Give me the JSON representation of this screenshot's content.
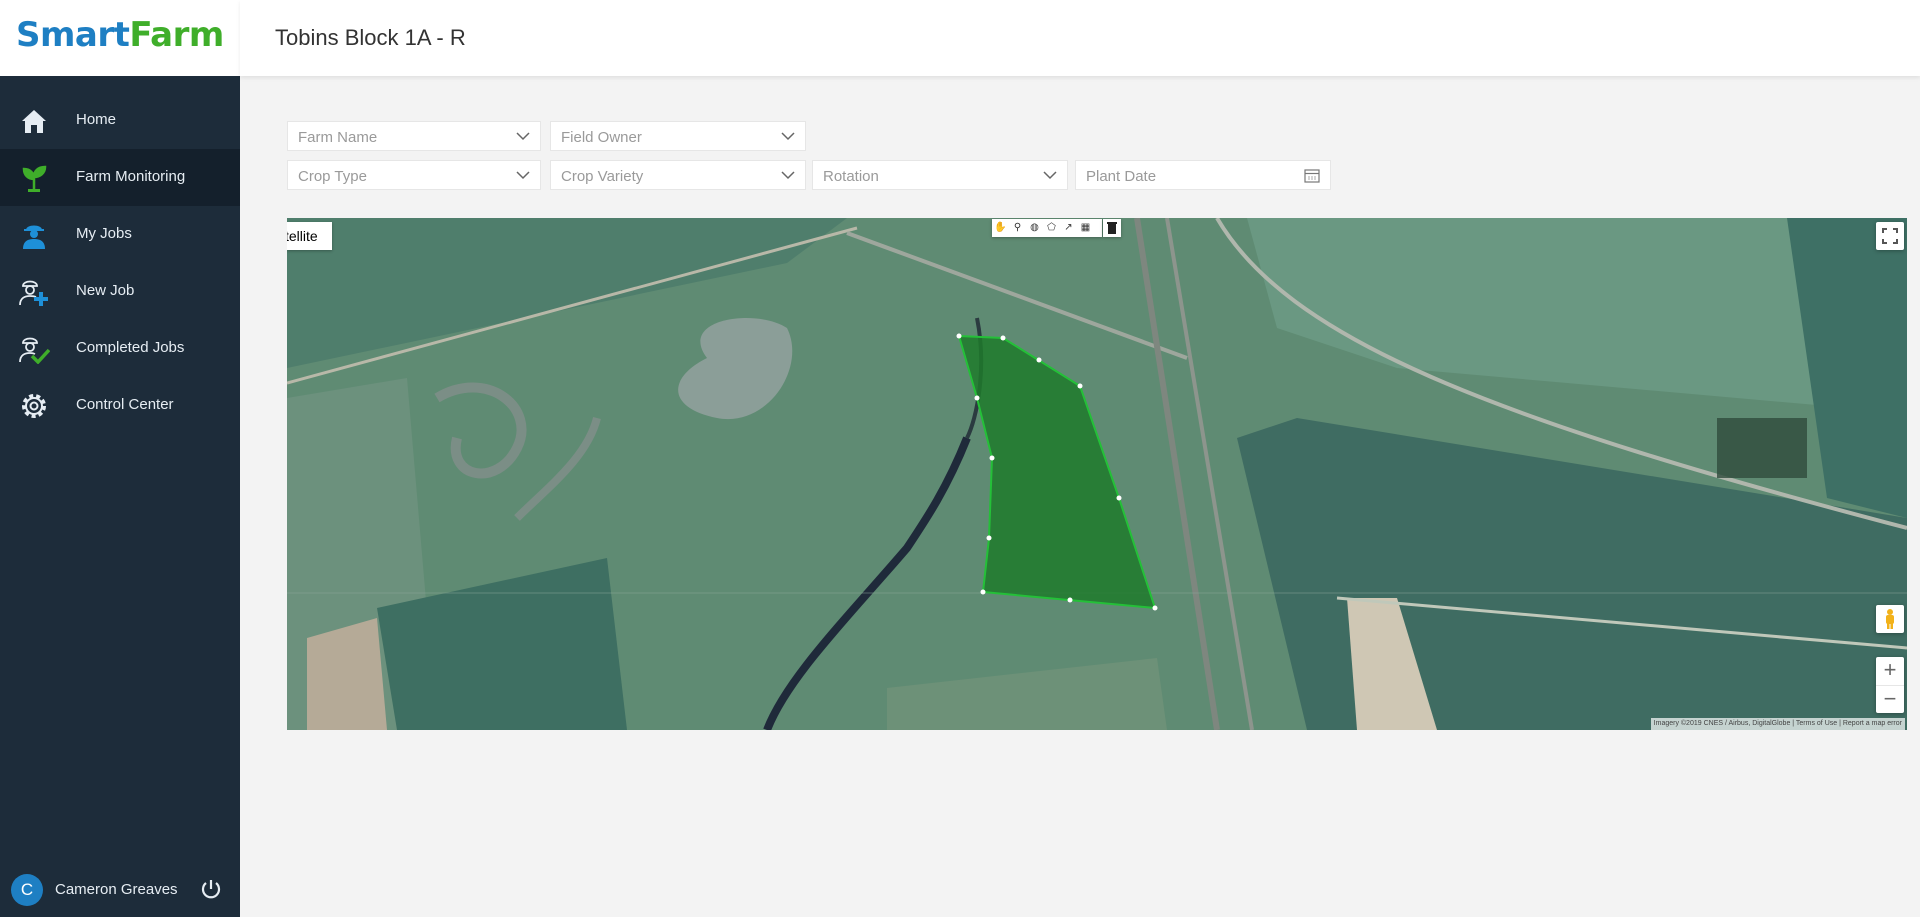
{
  "app": {
    "logo": {
      "part1": "Smart",
      "part2": "Farm",
      "color1": "#1e7fc3",
      "color2": "#3fae2a"
    },
    "title": "Tobins Block 1A - R"
  },
  "sidebar": {
    "items": [
      {
        "label": "Home",
        "icon": "home-icon",
        "active": false
      },
      {
        "label": "Farm Monitoring",
        "icon": "plant-icon",
        "active": true
      },
      {
        "label": "My Jobs",
        "icon": "worker-icon",
        "active": false
      },
      {
        "label": "New Job",
        "icon": "worker-add-icon",
        "active": false
      },
      {
        "label": "Completed Jobs",
        "icon": "worker-check-icon",
        "active": false
      },
      {
        "label": "Control Center",
        "icon": "gear-icon",
        "active": false
      }
    ],
    "user": {
      "initial": "C",
      "name": "Cameron Greaves"
    }
  },
  "filters": {
    "farm_name": "Farm Name",
    "field_owner": "Field Owner",
    "crop_type": "Crop Type",
    "crop_variety": "Crop Variety",
    "rotation": "Rotation",
    "plant_date": "Plant Date"
  },
  "map": {
    "type_label": "Satellite",
    "type_label_visible": "tellite",
    "zoom_in": "+",
    "zoom_out": "−",
    "attribution": "Imagery ©2019 CNES / Airbus, DigitalGlobe  |  Terms of Use  |  Report a map error",
    "field_color": "#1f7a2c"
  }
}
